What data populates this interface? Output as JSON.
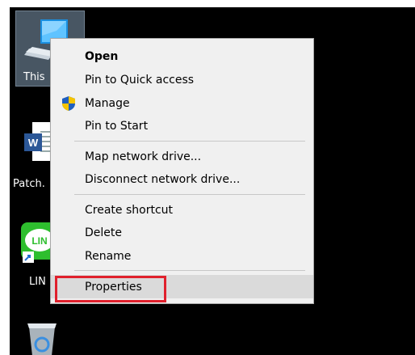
{
  "desktop": {
    "icons": [
      {
        "label": "This",
        "icon": "computer-icon"
      },
      {
        "label": "Patch.",
        "icon": "word-document-icon",
        "badge": "W"
      },
      {
        "label": "LIN",
        "icon": "line-app-icon",
        "badge": "LIN"
      },
      {
        "label": "",
        "icon": "recycle-bin-icon"
      }
    ]
  },
  "context_menu": {
    "items": [
      {
        "label": "Open",
        "bold": true
      },
      {
        "label": "Pin to Quick access"
      },
      {
        "label": "Manage",
        "icon": "shield-icon"
      },
      {
        "label": "Pin to Start"
      },
      {
        "label": "Map network drive..."
      },
      {
        "label": "Disconnect network drive..."
      },
      {
        "label": "Create shortcut"
      },
      {
        "label": "Delete"
      },
      {
        "label": "Rename"
      },
      {
        "label": "Properties",
        "highlighted": true
      }
    ]
  },
  "colors": {
    "desktop_bg": "#000000",
    "menu_bg": "#f0f0f0",
    "highlight_border": "#e0202c",
    "selection_bg": "#dadada",
    "line_green": "#2ebe2e",
    "word_blue": "#2b5797"
  }
}
